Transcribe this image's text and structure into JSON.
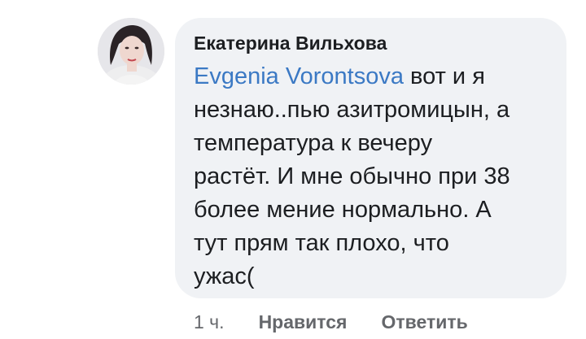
{
  "comment": {
    "author": "Екатерина Вильхова",
    "mention": "Evgenia Vorontsova",
    "text_line1_rest": " вот и я",
    "text_lines": [
      "незнаю..пью азитромицын, а",
      "температура к вечеру",
      "растёт. И мне обычно при 38",
      "более мение нормально. А",
      "тут прям так плохо, что",
      "ужас("
    ]
  },
  "actions": {
    "time": "1 ч.",
    "like_label": "Нравится",
    "reply_label": "Ответить"
  },
  "colors": {
    "bubble": "#f0f2f5",
    "mention": "#3b79c4",
    "meta": "#65676b"
  }
}
